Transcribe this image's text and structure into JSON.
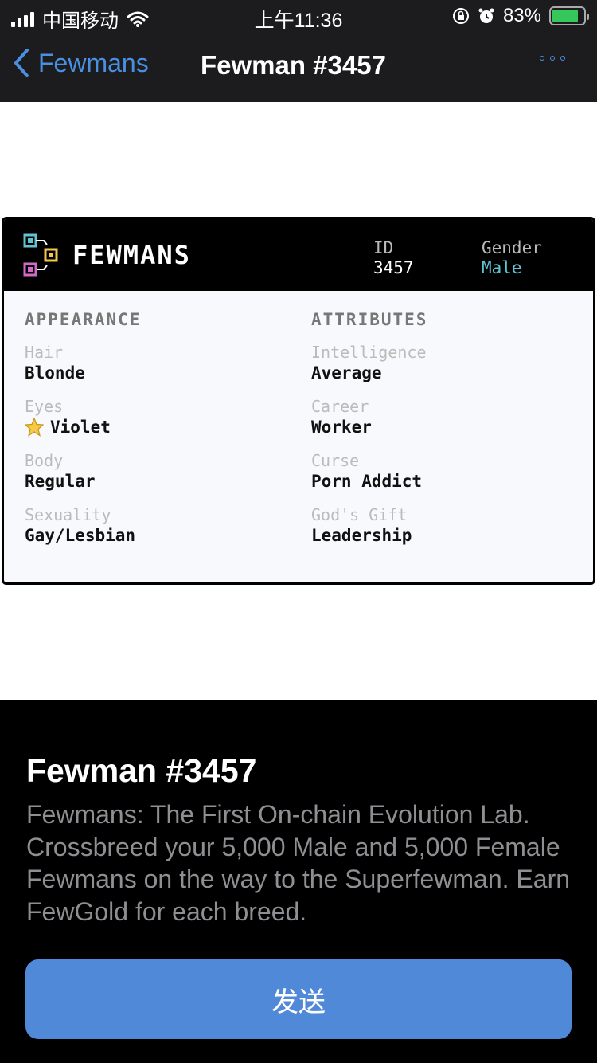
{
  "status_bar": {
    "carrier": "中国移动",
    "time": "上午11:36",
    "battery_percent": "83%",
    "battery_level": 0.83
  },
  "nav": {
    "back_label": "Fewmans",
    "title": "Fewman #3457"
  },
  "card": {
    "brand": "FEWMANS",
    "id_label": "ID",
    "id_value": "3457",
    "gender_label": "Gender",
    "gender_value": "Male",
    "appearance_heading": "APPEARANCE",
    "attributes_heading": "ATTRIBUTES",
    "appearance": [
      {
        "label": "Hair",
        "value": "Blonde"
      },
      {
        "label": "Eyes",
        "value": "Violet",
        "icon": "star-icon"
      },
      {
        "label": "Body",
        "value": "Regular"
      },
      {
        "label": "Sexuality",
        "value": "Gay/Lesbian"
      }
    ],
    "attributes": [
      {
        "label": "Intelligence",
        "value": "Average"
      },
      {
        "label": "Career",
        "value": "Worker"
      },
      {
        "label": "Curse",
        "value": "Porn Addict"
      },
      {
        "label": "God's Gift",
        "value": "Leadership"
      }
    ]
  },
  "sheet": {
    "title": "Fewman #3457",
    "description": "Fewmans: The First On-chain Evolution Lab. Crossbreed your 5,000 Male and 5,000 Female Fewmans on the way to the Superfewman. Earn FewGold for each breed.",
    "send_label": "发送"
  },
  "colors": {
    "accent": "#4a90e2",
    "button": "#5189d9",
    "gender": "#5ec4d2"
  }
}
